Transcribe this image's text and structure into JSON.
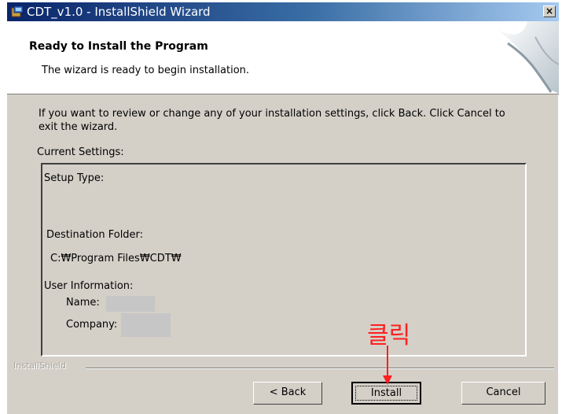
{
  "window": {
    "title": "CDT_v1.0 - InstallShield Wizard",
    "close_glyph": "×"
  },
  "header": {
    "title": "Ready to Install the Program",
    "subtitle": "The wizard is ready to begin installation."
  },
  "body": {
    "instruction_line1": "If you want to review or change any of your installation settings, click Back. Click Cancel to",
    "instruction_line2": "exit the wizard.",
    "current_settings_label": "Current Settings:",
    "setup_type_label": "Setup Type:",
    "destination_folder_label": "Destination Folder:",
    "destination_folder_value": "C:₩Program Files₩CDT₩",
    "user_information_label": "User Information:",
    "name_label": "Name:",
    "company_label": "Company:"
  },
  "footer": {
    "brand": "InstallShield"
  },
  "buttons": {
    "back": "< Back",
    "install": "Install",
    "cancel": "Cancel"
  },
  "annotation": {
    "text": "클릭",
    "color": "#ff2020"
  },
  "colors": {
    "dialog_face": "#d4d0c8",
    "title_bar": "#0a246a"
  },
  "icons": [
    "installer-icon",
    "close-icon",
    "header-graphic-icon",
    "arrow-down-icon"
  ]
}
